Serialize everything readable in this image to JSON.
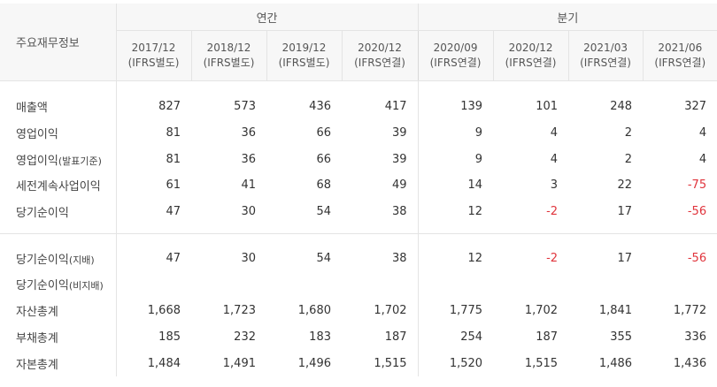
{
  "header": {
    "corner_label": "주요재무정보",
    "annual_label": "연간",
    "quarterly_label": "분기",
    "annual_periods": [
      {
        "date": "2017/12",
        "basis": "(IFRS별도)"
      },
      {
        "date": "2018/12",
        "basis": "(IFRS별도)"
      },
      {
        "date": "2019/12",
        "basis": "(IFRS별도)"
      },
      {
        "date": "2020/12",
        "basis": "(IFRS연결)"
      }
    ],
    "quarterly_periods": [
      {
        "date": "2020/09",
        "basis": "(IFRS연결)"
      },
      {
        "date": "2020/12",
        "basis": "(IFRS연결)"
      },
      {
        "date": "2021/03",
        "basis": "(IFRS연결)"
      },
      {
        "date": "2021/06",
        "basis": "(IFRS연결)"
      }
    ]
  },
  "rows": [
    {
      "label": "매출액",
      "label_suffix": "",
      "values": [
        "827",
        "573",
        "436",
        "417",
        "139",
        "101",
        "248",
        "327"
      ]
    },
    {
      "label": "영업이익",
      "label_suffix": "",
      "values": [
        "81",
        "36",
        "66",
        "39",
        "9",
        "4",
        "2",
        "4"
      ]
    },
    {
      "label": "영업이익",
      "label_suffix": "(발표기준)",
      "values": [
        "81",
        "36",
        "66",
        "39",
        "9",
        "4",
        "2",
        "4"
      ]
    },
    {
      "label": "세전계속사업이익",
      "label_suffix": "",
      "values": [
        "61",
        "41",
        "68",
        "49",
        "14",
        "3",
        "22",
        "-75"
      ]
    },
    {
      "label": "당기순이익",
      "label_suffix": "",
      "values": [
        "47",
        "30",
        "54",
        "38",
        "12",
        "-2",
        "17",
        "-56"
      ]
    },
    {
      "label": "당기순이익",
      "label_suffix": "(지배)",
      "values": [
        "47",
        "30",
        "54",
        "38",
        "12",
        "-2",
        "17",
        "-56"
      ]
    },
    {
      "label": "당기순이익",
      "label_suffix": "(비지배)",
      "values": [
        "",
        "",
        "",
        "",
        "",
        "",
        "",
        ""
      ]
    },
    {
      "label": "자산총계",
      "label_suffix": "",
      "values": [
        "1,668",
        "1,723",
        "1,680",
        "1,702",
        "1,775",
        "1,702",
        "1,841",
        "1,772"
      ]
    },
    {
      "label": "부채총계",
      "label_suffix": "",
      "values": [
        "185",
        "232",
        "183",
        "187",
        "254",
        "187",
        "355",
        "336"
      ]
    },
    {
      "label": "자본총계",
      "label_suffix": "",
      "values": [
        "1,484",
        "1,491",
        "1,496",
        "1,515",
        "1,520",
        "1,515",
        "1,486",
        "1,436"
      ]
    }
  ],
  "colors": {
    "negative": "#e0343c",
    "header_bg": "#f7f7f7",
    "border": "#e4e4e4"
  }
}
